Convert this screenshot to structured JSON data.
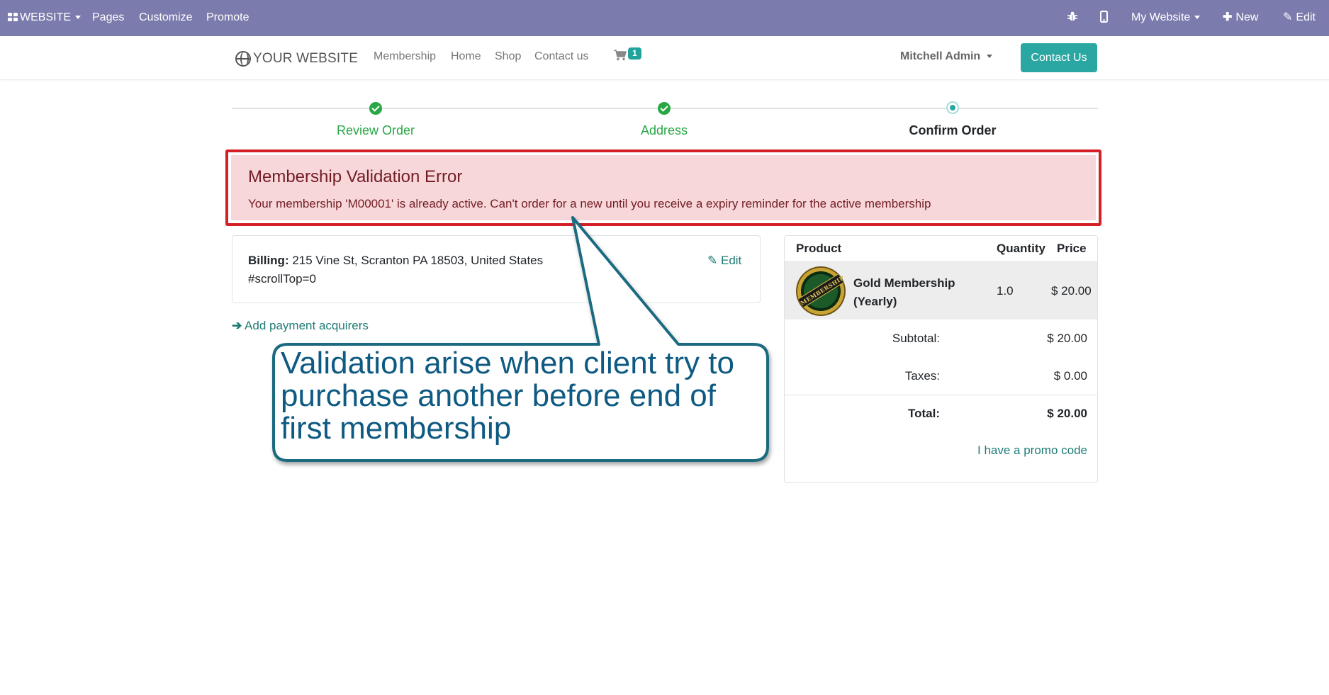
{
  "admin_bar": {
    "app_label": "WEBSITE",
    "pages": "Pages",
    "customize": "Customize",
    "promote": "Promote",
    "icons": [
      "bug-icon",
      "mobile-icon"
    ],
    "site_select": "My Website",
    "new_label": "New",
    "edit_label": "Edit",
    "background": "#7c7bad"
  },
  "navbar": {
    "logo": "YOUR WEBSITE",
    "links": [
      "Membership",
      "Home",
      "Shop",
      "Contact us"
    ],
    "cart_count": "1",
    "user": "Mitchell Admin",
    "contact_button": "Contact Us",
    "accent": "#2aa7a2"
  },
  "steps": [
    {
      "label": "Review Order",
      "state": "done"
    },
    {
      "label": "Address",
      "state": "done"
    },
    {
      "label": "Confirm Order",
      "state": "current"
    }
  ],
  "alert": {
    "title": "Membership Validation Error",
    "message": "Your membership 'M00001' is already active. Can't order for a new until you receive a expiry reminder for the active membership"
  },
  "billing": {
    "label": "Billing:",
    "address": "215 Vine St, Scranton PA 18503, United States",
    "extra": "#scrollTop=0",
    "edit": "Edit"
  },
  "add_payment": "Add payment acquirers",
  "order": {
    "headers": {
      "product": "Product",
      "quantity": "Quantity",
      "price": "Price"
    },
    "line": {
      "image_text": "MEMBERSHIP",
      "name": "Gold Membership (Yearly)",
      "quantity": "1.0",
      "price": "$ 20.00"
    },
    "subtotal_label": "Subtotal:",
    "subtotal": "$ 20.00",
    "taxes_label": "Taxes:",
    "taxes": "$ 0.00",
    "total_label": "Total:",
    "total": "$ 20.00",
    "promo": "I have a promo code"
  },
  "callout": {
    "text": "Validation arise when client try to purchase another before end of first membership"
  }
}
